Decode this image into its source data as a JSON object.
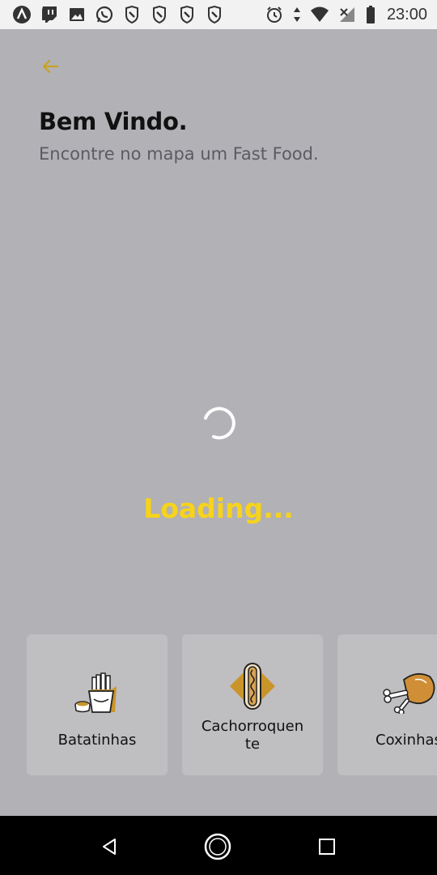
{
  "status_bar": {
    "time": "23:00",
    "left_icons": [
      "app-a-icon",
      "twitch-icon",
      "image-icon",
      "whatsapp-icon",
      "tag-icon",
      "tag-icon",
      "tag-icon",
      "tag-icon"
    ],
    "right_icons": [
      "alarm-icon",
      "data-arrows-icon",
      "wifi-icon",
      "signal-off-icon",
      "battery-icon"
    ]
  },
  "header": {
    "back_icon": "arrow-left-icon",
    "title": "Bem Vindo.",
    "subtitle": "Encontre no mapa um Fast Food."
  },
  "loading": {
    "text": "Loading..."
  },
  "categories": [
    {
      "label": "Batatinhas",
      "icon": "fries-icon"
    },
    {
      "label": "Cachorroquen te",
      "label_line1": "Cachorroquen",
      "label_line2": "te",
      "icon": "hotdog-icon"
    },
    {
      "label": "Coxinhas",
      "icon": "drumstick-icon"
    }
  ],
  "colors": {
    "background": "#b2b1b6",
    "accent": "#f7d31a",
    "back_arrow": "#c9a21c",
    "card": "#bfbfc2"
  },
  "nav_bar": {
    "icons": [
      "nav-back-icon",
      "nav-home-icon",
      "nav-recents-icon"
    ]
  }
}
